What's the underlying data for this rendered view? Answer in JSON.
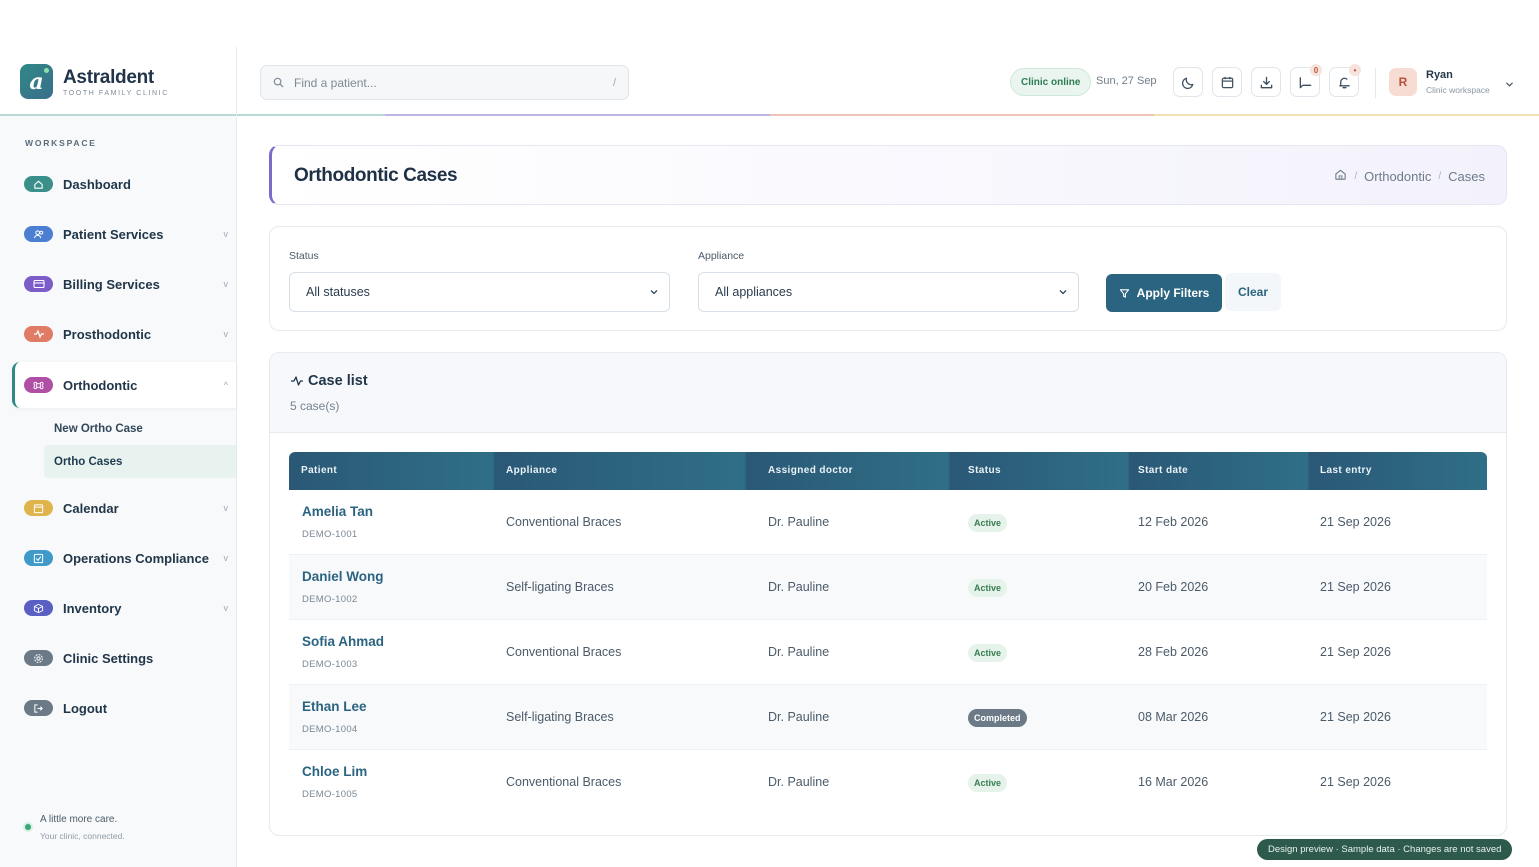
{
  "brand": {
    "name": "Astraldent",
    "tagline": "TOOTH FAMILY CLINIC",
    "logo_letter": "a"
  },
  "colors": {
    "accent": "#2b6480",
    "teal": "#2f8a86",
    "purple": "#7a6cc8",
    "coral": "#e07b66",
    "gold": "#e0b44c"
  },
  "search": {
    "placeholder": "Find a patient...",
    "shortcut": "/"
  },
  "header": {
    "status_badge": "Clinic online",
    "date": "Sun, 27 Sep",
    "tools": [
      {
        "icon": "moon-icon"
      },
      {
        "icon": "calendar-icon"
      },
      {
        "icon": "download-icon"
      },
      {
        "icon": "message-icon",
        "badge": "0"
      },
      {
        "icon": "bell-icon",
        "badge": "•"
      }
    ],
    "user": {
      "initial": "R",
      "name": "Ryan",
      "role": "Clinic workspace"
    }
  },
  "sidebar": {
    "section_label": "WORKSPACE",
    "items": [
      {
        "label": "Dashboard",
        "icon": "home-icon"
      },
      {
        "label": "Patient Services",
        "icon": "users-icon",
        "chevron": "v"
      },
      {
        "label": "Billing Services",
        "icon": "card-icon",
        "chevron": "v"
      },
      {
        "label": "Prosthodontic",
        "icon": "pulse-icon",
        "chevron": "v"
      },
      {
        "label": "Orthodontic",
        "icon": "command-icon",
        "chevron": "^",
        "expanded": true
      },
      {
        "label": "Calendar",
        "icon": "calendar-icon",
        "chevron": "v"
      },
      {
        "label": "Operations Compliance",
        "icon": "checklist-icon",
        "chevron": "v"
      },
      {
        "label": "Inventory",
        "icon": "box-icon",
        "chevron": "v"
      },
      {
        "label": "Clinic Settings",
        "icon": "gear-icon"
      },
      {
        "label": "Logout",
        "icon": "logout-icon"
      }
    ],
    "subitems": [
      {
        "label": "New Ortho Case"
      },
      {
        "label": "Ortho Cases",
        "active": true
      }
    ],
    "footer": {
      "line1": "A little more care.",
      "line2": "Your clinic, connected."
    }
  },
  "page": {
    "title": "Orthodontic Cases",
    "breadcrumb": [
      "Orthodontic",
      "Cases"
    ],
    "breadcrumb_sep": "/"
  },
  "filters": {
    "status_label": "Status",
    "status_value": "All statuses",
    "appliance_label": "Appliance",
    "appliance_value": "All appliances",
    "apply_label": "Apply Filters",
    "clear_label": "Clear"
  },
  "case_list": {
    "title": "Case list",
    "count": "5 case(s)",
    "columns": [
      "Patient",
      "Appliance",
      "Assigned doctor",
      "Status",
      "Start date",
      "Last entry"
    ],
    "rows": [
      {
        "name": "Amelia Tan",
        "id": "DEMO-1001",
        "appliance": "Conventional Braces",
        "doctor": "Dr. Pauline",
        "status": "Active",
        "start": "12 Feb 2026",
        "last": "21 Sep 2026"
      },
      {
        "name": "Daniel Wong",
        "id": "DEMO-1002",
        "appliance": "Self-ligating Braces",
        "doctor": "Dr. Pauline",
        "status": "Active",
        "start": "20 Feb 2026",
        "last": "21 Sep 2026"
      },
      {
        "name": "Sofia Ahmad",
        "id": "DEMO-1003",
        "appliance": "Conventional Braces",
        "doctor": "Dr. Pauline",
        "status": "Active",
        "start": "28 Feb 2026",
        "last": "21 Sep 2026"
      },
      {
        "name": "Ethan Lee",
        "id": "DEMO-1004",
        "appliance": "Self-ligating Braces",
        "doctor": "Dr. Pauline",
        "status": "Completed",
        "start": "08 Mar 2026",
        "last": "21 Sep 2026"
      },
      {
        "name": "Chloe Lim",
        "id": "DEMO-1005",
        "appliance": "Conventional Braces",
        "doctor": "Dr. Pauline",
        "status": "Active",
        "start": "16 Mar 2026",
        "last": "21 Sep 2026"
      }
    ]
  },
  "preview_banner": "Design preview · Sample data · Changes are not saved"
}
